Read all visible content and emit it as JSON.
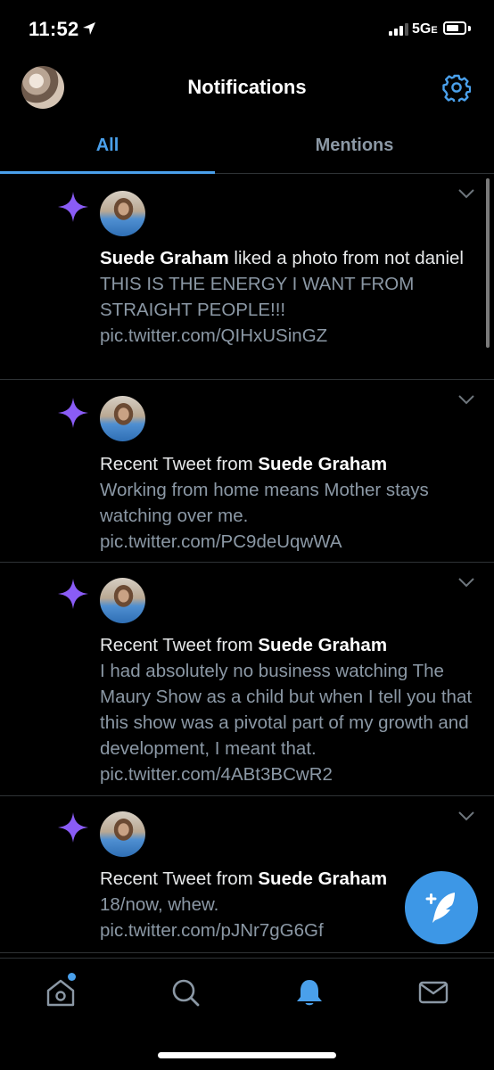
{
  "status_bar": {
    "time": "11:52",
    "network": "5G",
    "network_suffix": "E"
  },
  "header": {
    "title": "Notifications",
    "avatar_icon": "profile-photo",
    "settings_icon": "gear-icon"
  },
  "tabs": [
    {
      "label": "All",
      "active": true
    },
    {
      "label": "Mentions",
      "active": false
    }
  ],
  "notifications": [
    {
      "icon": "sparkle-icon",
      "actor": "Suede Graham",
      "action": " liked a photo from not daniel",
      "text": "THIS IS THE ENERGY I WANT FROM STRAIGHT PEOPLE!!! pic.twitter.com/QIHxUSinGZ"
    },
    {
      "icon": "sparkle-icon",
      "prefix": "Recent Tweet from ",
      "actor": "Suede Graham",
      "text": "Working from home means Mother stays watching over me. pic.twitter.com/PC9deUqwWA"
    },
    {
      "icon": "sparkle-icon",
      "prefix": "Recent Tweet from ",
      "actor": "Suede Graham",
      "text": "I had absolutely no business watching The Maury Show as a child but when I tell you that this show was a pivotal part of my growth and development, I meant that. pic.twitter.com/4ABt3BCwR2"
    },
    {
      "icon": "sparkle-icon",
      "prefix": "Recent Tweet from ",
      "actor": "Suede Graham",
      "text": "18/now, whew. pic.twitter.com/pJNr7gG6Gf"
    }
  ],
  "fab": {
    "icon": "compose-tweet-icon"
  },
  "bottom_nav": [
    {
      "icon": "home-icon",
      "has_dot": true
    },
    {
      "icon": "search-icon"
    },
    {
      "icon": "bell-icon",
      "active": true
    },
    {
      "icon": "mail-icon"
    }
  ],
  "colors": {
    "accent": "#4aa0eb",
    "sparkle": "#8a5cf6",
    "background": "#000000",
    "muted_text": "#8b98a5"
  }
}
